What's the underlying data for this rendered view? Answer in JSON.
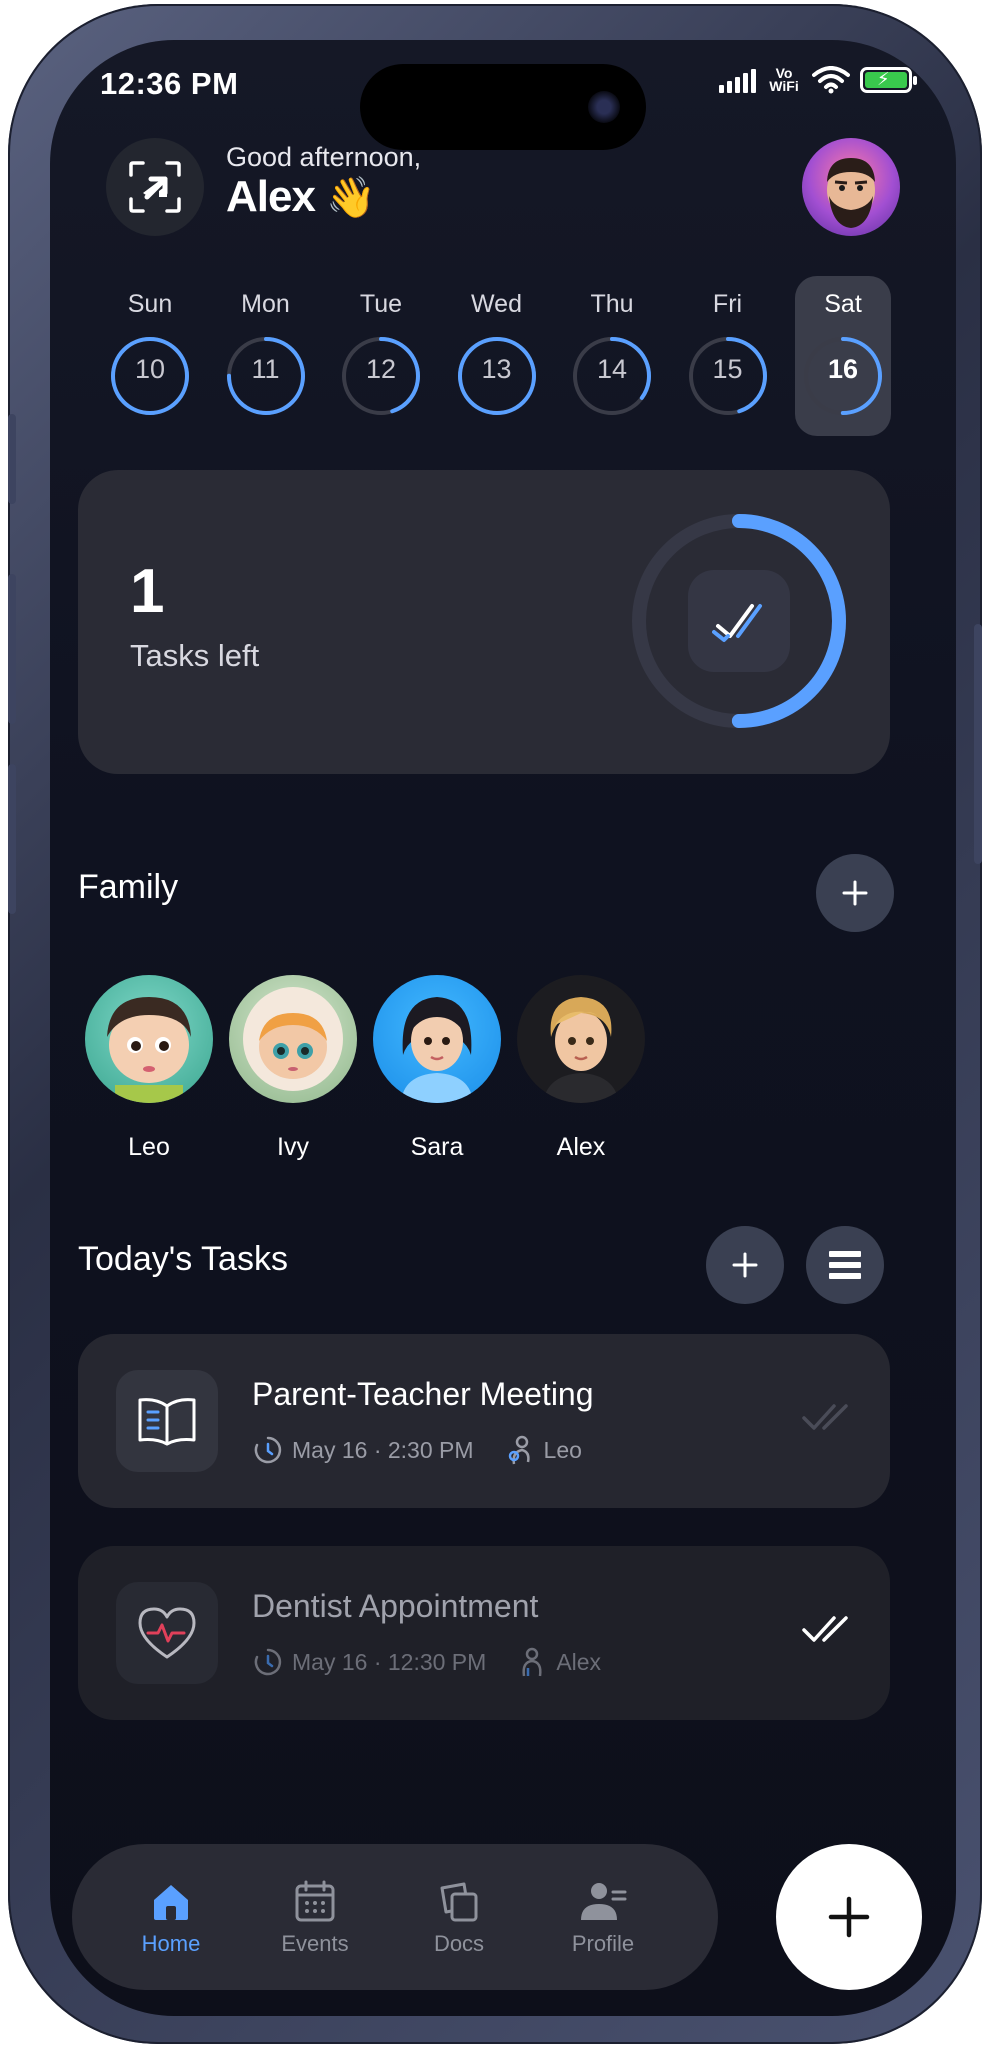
{
  "status_bar": {
    "time": "12:36 PM",
    "network": "Vo WiFi"
  },
  "header": {
    "greeting": "Good afternoon,",
    "name": "Alex",
    "wave": "👋"
  },
  "week": [
    {
      "day": "Sun",
      "date": "10",
      "progress": 1.0
    },
    {
      "day": "Mon",
      "date": "11",
      "progress": 0.75
    },
    {
      "day": "Tue",
      "date": "12",
      "progress": 0.45
    },
    {
      "day": "Wed",
      "date": "13",
      "progress": 1.0
    },
    {
      "day": "Thu",
      "date": "14",
      "progress": 0.35
    },
    {
      "day": "Fri",
      "date": "15",
      "progress": 0.45
    },
    {
      "day": "Sat",
      "date": "16",
      "progress": 0.5,
      "active": true
    }
  ],
  "summary": {
    "count": "1",
    "label": "Tasks left",
    "progress": 0.5
  },
  "family": {
    "title": "Family",
    "members": [
      {
        "name": "Leo"
      },
      {
        "name": "Ivy"
      },
      {
        "name": "Sara"
      },
      {
        "name": "Alex"
      }
    ]
  },
  "tasks": {
    "title": "Today's Tasks",
    "items": [
      {
        "title": "Parent-Teacher Meeting",
        "when": "May 16 · 2:30 PM",
        "member": "Leo",
        "done": false
      },
      {
        "title": "Dentist Appointment",
        "when": "May 16 · 12:30 PM",
        "member": "Alex",
        "done": true
      }
    ]
  },
  "nav": {
    "items": [
      {
        "label": "Home",
        "icon": "home-icon",
        "active": true
      },
      {
        "label": "Events",
        "icon": "calendar-icon"
      },
      {
        "label": "Docs",
        "icon": "docs-icon"
      },
      {
        "label": "Profile",
        "icon": "profile-icon"
      }
    ]
  },
  "colors": {
    "accent": "#5aa0ff",
    "card": "#2a2b35",
    "background": "#0f1220"
  }
}
